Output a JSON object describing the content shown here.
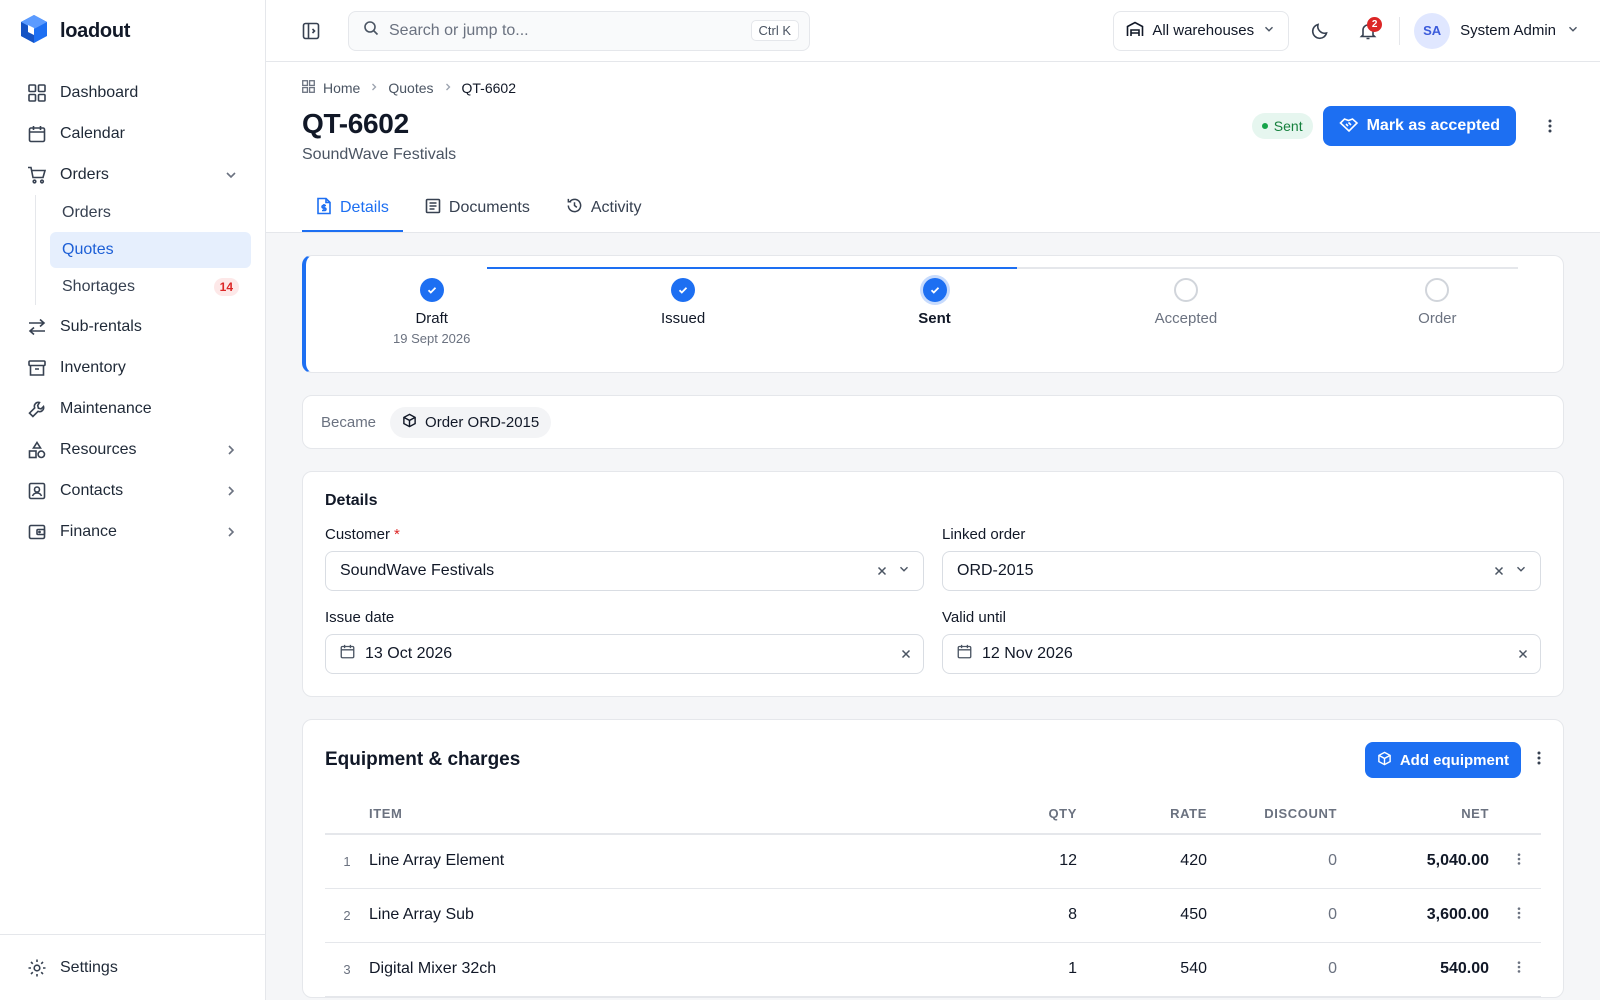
{
  "app": {
    "name": "loadout"
  },
  "sidebar": {
    "items": [
      {
        "label": "Dashboard"
      },
      {
        "label": "Calendar"
      },
      {
        "label": "Orders"
      },
      {
        "label": "Sub-rentals"
      },
      {
        "label": "Inventory"
      },
      {
        "label": "Maintenance"
      },
      {
        "label": "Resources"
      },
      {
        "label": "Contacts"
      },
      {
        "label": "Finance"
      }
    ],
    "orders_sub": [
      {
        "label": "Orders"
      },
      {
        "label": "Quotes"
      },
      {
        "label": "Shortages",
        "badge": "14"
      }
    ],
    "settings": "Settings"
  },
  "topbar": {
    "search_placeholder": "Search or jump to...",
    "shortcut": "Ctrl K",
    "warehouse": "All warehouses",
    "notifications": "2",
    "user_initials": "SA",
    "user_name": "System Admin"
  },
  "breadcrumb": [
    "Home",
    "Quotes",
    "QT-6602"
  ],
  "page": {
    "title": "QT-6602",
    "subtitle": "SoundWave Festivals",
    "status": "Sent",
    "primary_action": "Mark as accepted"
  },
  "tabs": [
    {
      "label": "Details"
    },
    {
      "label": "Documents"
    },
    {
      "label": "Activity"
    }
  ],
  "stepper": [
    {
      "label": "Draft",
      "date": "19 Sept 2026",
      "state": "done"
    },
    {
      "label": "Issued",
      "date": "",
      "state": "done"
    },
    {
      "label": "Sent",
      "date": "",
      "state": "current"
    },
    {
      "label": "Accepted",
      "date": "",
      "state": "todo"
    },
    {
      "label": "Order",
      "date": "",
      "state": "todo"
    }
  ],
  "became": {
    "label": "Became",
    "chip": "Order ORD-2015"
  },
  "details": {
    "title": "Details",
    "customer_label": "Customer",
    "customer_required": "*",
    "customer_value": "SoundWave Festivals",
    "linked_label": "Linked order",
    "linked_value": "ORD-2015",
    "issue_label": "Issue date",
    "issue_value": "13 Oct 2026",
    "valid_label": "Valid until",
    "valid_value": "12 Nov 2026"
  },
  "equipment": {
    "title": "Equipment & charges",
    "add_label": "Add equipment",
    "columns": {
      "item": "ITEM",
      "qty": "QTY",
      "rate": "RATE",
      "discount": "DISCOUNT",
      "net": "NET"
    },
    "rows": [
      {
        "n": "1",
        "item": "Line Array Element",
        "qty": "12",
        "rate": "420",
        "discount": "0",
        "net": "5,040.00"
      },
      {
        "n": "2",
        "item": "Line Array Sub",
        "qty": "8",
        "rate": "450",
        "discount": "0",
        "net": "3,600.00"
      },
      {
        "n": "3",
        "item": "Digital Mixer 32ch",
        "qty": "1",
        "rate": "540",
        "discount": "0",
        "net": "540.00"
      }
    ]
  },
  "colors": {
    "accent": "#1d6ff2",
    "danger": "#dc2626",
    "success": "#16a34a"
  }
}
